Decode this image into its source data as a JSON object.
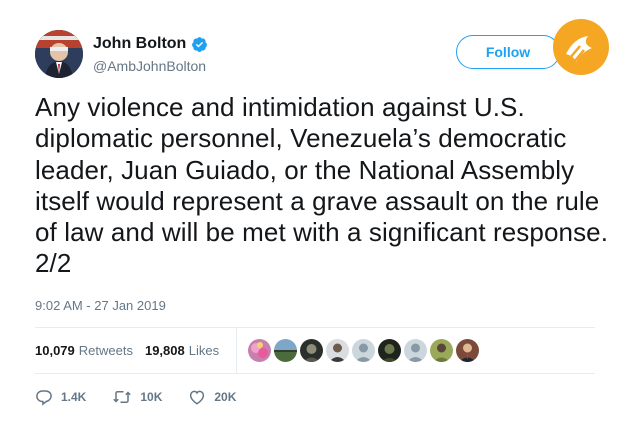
{
  "user": {
    "display_name": "John Bolton",
    "handle": "@AmbJohnBolton",
    "verified": true,
    "verified_color": "#1da1f2",
    "avatar_icon": "profile-photo"
  },
  "follow_button": {
    "label": "Follow",
    "color": "#1da1f2"
  },
  "watermark": {
    "icon": "watermark-logo",
    "color": "#f5a623"
  },
  "tweet": {
    "text": "Any violence and intimidation against U.S. diplomatic personnel, Venezuela’s democratic leader, Juan Guiado, or the National Assembly itself would represent a grave assault on the rule of law and will be met with a significant response. 2/2",
    "timestamp": "9:02 AM - 27 Jan 2019"
  },
  "stats": {
    "retweets": {
      "count": "10,079",
      "label": "Retweets"
    },
    "likes": {
      "count": "19,808",
      "label": "Likes"
    }
  },
  "likers": [
    {
      "icon": "liker-avatar-flowers"
    },
    {
      "icon": "liker-avatar-landscape"
    },
    {
      "icon": "liker-avatar-dark"
    },
    {
      "icon": "liker-avatar-person"
    },
    {
      "icon": "liker-avatar-default"
    },
    {
      "icon": "liker-avatar-dark-2"
    },
    {
      "icon": "liker-avatar-default-2"
    },
    {
      "icon": "liker-avatar-green"
    },
    {
      "icon": "liker-avatar-suit"
    }
  ],
  "actions": {
    "replies": "1.4K",
    "retweets": "10K",
    "likes": "20K"
  },
  "colors": {
    "text_primary": "#14171a",
    "text_secondary": "#657786",
    "accent": "#1da1f2",
    "divider": "#e6ecf0"
  }
}
